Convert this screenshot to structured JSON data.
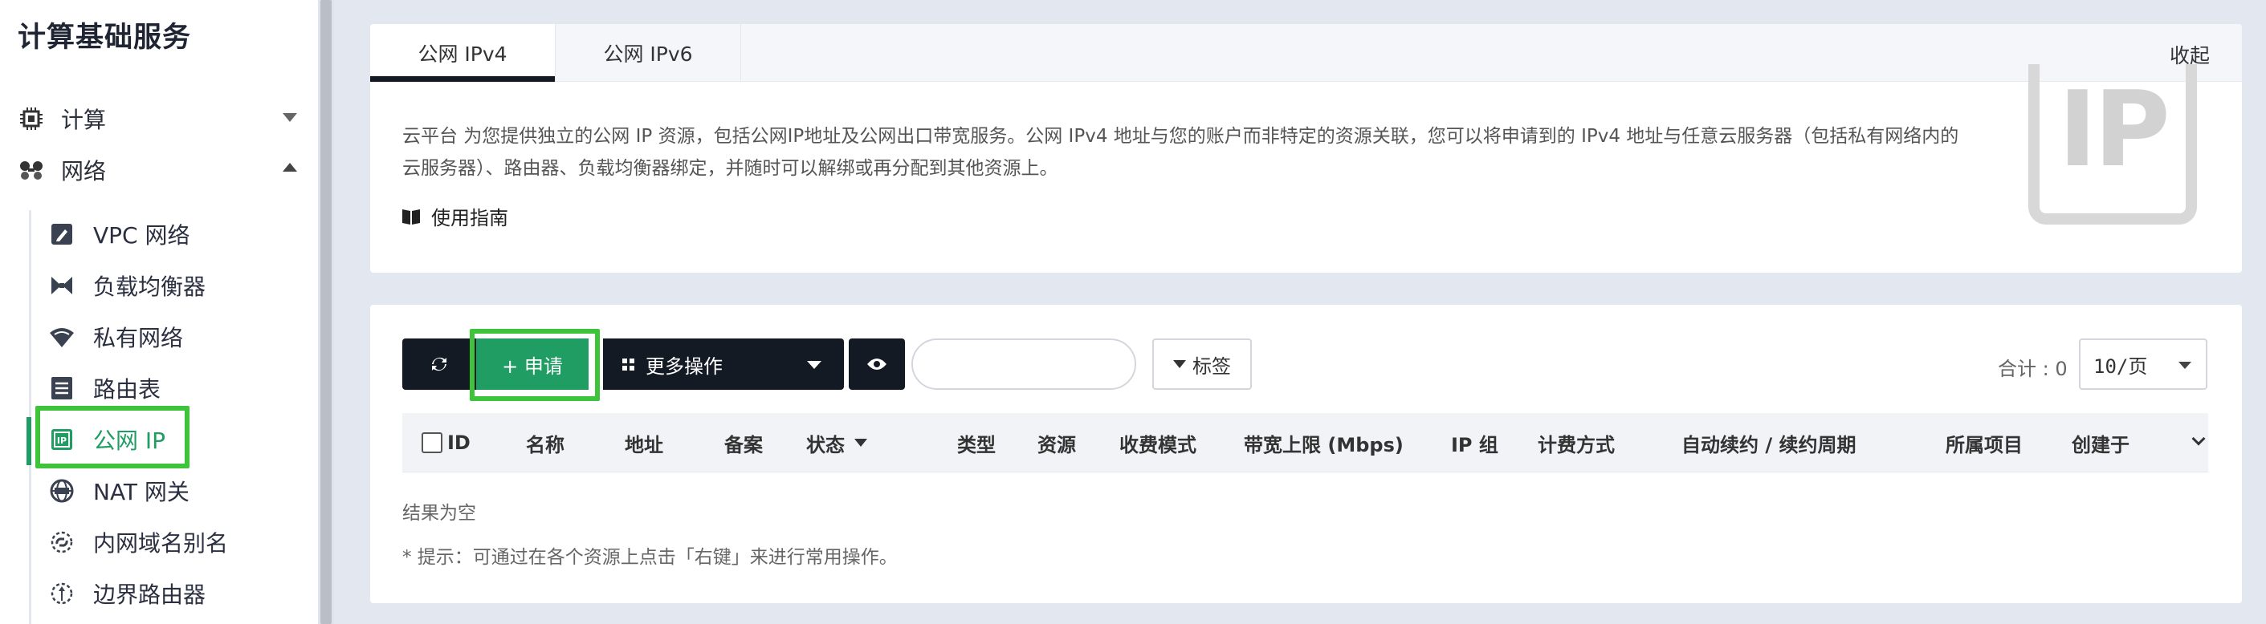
{
  "sidebar": {
    "title": "计算基础服务",
    "groups": [
      {
        "label": "计算",
        "expanded": false
      },
      {
        "label": "网络",
        "expanded": true
      }
    ],
    "items": [
      {
        "label": "VPC 网络",
        "icon": "vpc-icon"
      },
      {
        "label": "负载均衡器",
        "icon": "load-balancer-icon"
      },
      {
        "label": "私有网络",
        "icon": "wifi-icon"
      },
      {
        "label": "路由表",
        "icon": "route-table-icon"
      },
      {
        "label": "公网 IP",
        "icon": "ip-icon",
        "active": true
      },
      {
        "label": "NAT 网关",
        "icon": "nat-gateway-icon"
      },
      {
        "label": "内网域名别名",
        "icon": "dns-alias-icon"
      },
      {
        "label": "边界路由器",
        "icon": "border-router-icon"
      }
    ]
  },
  "tabs": [
    {
      "label": "公网 IPv4",
      "active": true
    },
    {
      "label": "公网 IPv6",
      "active": false
    }
  ],
  "collapse_label": "收起",
  "description": "云平台 为您提供独立的公网 IP 资源，包括公网IP地址及公网出口带宽服务。公网 IPv4 地址与您的账户而非特定的资源关联，您可以将申请到的 IPv4 地址与任意云服务器（包括私有网络内的云服务器）、路由器、负载均衡器绑定，并随时可以解绑或再分配到其他资源上。",
  "guide_label": "使用指南",
  "badge_text": "IP",
  "toolbar": {
    "apply_label": "+ 申请",
    "more_label": "更多操作",
    "search_placeholder": "",
    "tag_label": "标签",
    "total_label": "合计 : 0",
    "page_size": "10/页"
  },
  "table": {
    "columns": [
      "ID",
      "名称",
      "地址",
      "备案",
      "状态",
      "类型",
      "资源",
      "收费模式",
      "带宽上限 (Mbps)",
      "IP 组",
      "计费方式",
      "自动续约 / 续约周期",
      "所属项目",
      "创建于"
    ],
    "empty_text": "结果为空",
    "hint": "* 提示：可通过在各个资源上点击「右键」来进行常用操作。"
  },
  "colors": {
    "accent_green": "#1f9d63",
    "dark_button": "#141a23",
    "highlight": "#3ec43a"
  }
}
